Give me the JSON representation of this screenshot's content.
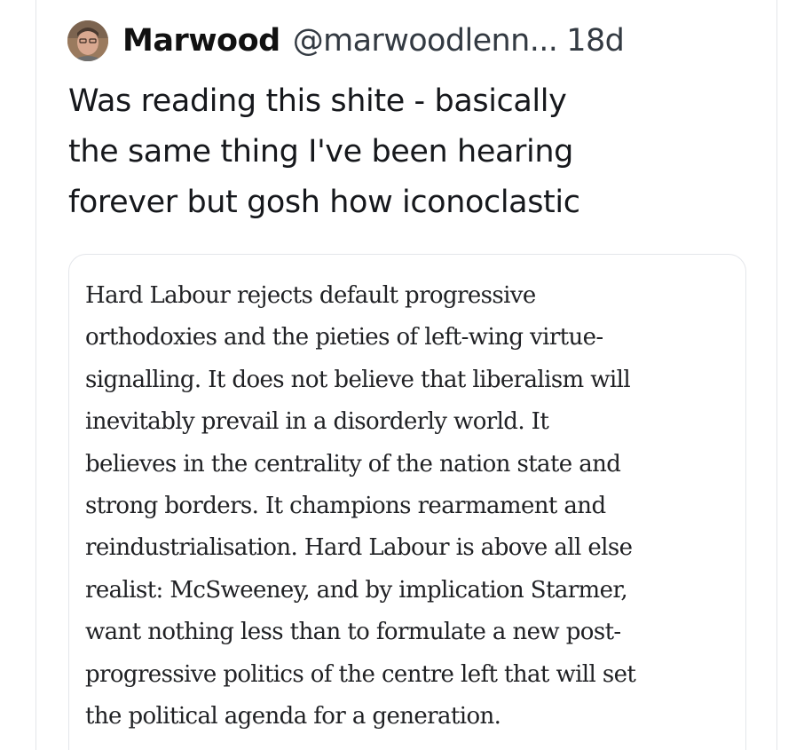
{
  "post": {
    "author": {
      "display_name": "Marwood",
      "handle": "@marwoodlenn...",
      "avatar": "user-avatar-photo"
    },
    "timestamp": "18d",
    "text_lines": [
      "Was reading this shite - basically",
      "the same thing I've been hearing",
      "forever but gosh how iconoclastic"
    ]
  },
  "quoted_image": {
    "text_lines": [
      "Hard Labour rejects default progressive",
      "orthodoxies and the pieties of left-wing virtue-",
      "signalling. It does not believe that liberalism will",
      "inevitably prevail in a disorderly world. It",
      "believes in the centrality of the nation state and",
      "strong borders. It champions rearmament and",
      "reindustrialisation. Hard Labour is above all else",
      "realist: McSweeney, and by implication Starmer,",
      "want nothing less than to formulate a new post-",
      "progressive politics of the centre left that will set",
      "the political agenda for a generation."
    ]
  },
  "colors": {
    "text_primary": "#16181c",
    "text_secondary": "#333a42",
    "border": "#e4e6ea",
    "background": "#ffffff"
  }
}
